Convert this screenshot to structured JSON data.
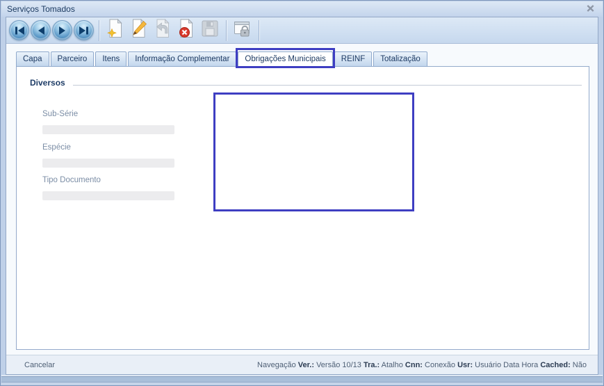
{
  "window": {
    "title": "Serviços Tomados"
  },
  "toolbar": {
    "buttons": [
      {
        "name": "first-record",
        "icon": "nav-first-icon",
        "enabled": true
      },
      {
        "name": "prior-record",
        "icon": "nav-prior-icon",
        "enabled": true
      },
      {
        "name": "next-record",
        "icon": "nav-next-icon",
        "enabled": true
      },
      {
        "name": "last-record",
        "icon": "nav-last-icon",
        "enabled": true
      },
      {
        "name": "new-record",
        "icon": "document-new-icon",
        "enabled": true
      },
      {
        "name": "edit-record",
        "icon": "document-edit-icon",
        "enabled": true
      },
      {
        "name": "undo-record",
        "icon": "document-undo-icon",
        "enabled": false
      },
      {
        "name": "delete-record",
        "icon": "document-delete-icon",
        "enabled": true
      },
      {
        "name": "save-record",
        "icon": "save-disk-icon",
        "enabled": false
      },
      {
        "name": "security",
        "icon": "window-lock-icon",
        "enabled": true
      }
    ]
  },
  "tabs": {
    "items": [
      {
        "label": "Capa",
        "active": false
      },
      {
        "label": "Parceiro",
        "active": false
      },
      {
        "label": "Itens",
        "active": false
      },
      {
        "label": "Informação Complementar",
        "active": false
      },
      {
        "label": "Obrigações Municipais",
        "active": true
      },
      {
        "label": "REINF",
        "active": false
      },
      {
        "label": "Totalização",
        "active": false
      }
    ]
  },
  "form": {
    "group_title": "Diversos",
    "fields": [
      {
        "label": "Sub-Série",
        "value": ""
      },
      {
        "label": "Espécie",
        "value": ""
      },
      {
        "label": "Tipo Documento",
        "value": ""
      }
    ]
  },
  "status_bar": {
    "left": "Cancelar",
    "right": [
      {
        "text": "Navegação ",
        "bold": false
      },
      {
        "text": "Ver.:",
        "bold": true
      },
      {
        "text": " Versão 10/13 ",
        "bold": false
      },
      {
        "text": "Tra.:",
        "bold": true
      },
      {
        "text": " Atalho ",
        "bold": false
      },
      {
        "text": "Cnn:",
        "bold": true
      },
      {
        "text": " Conexão ",
        "bold": false
      },
      {
        "text": "Usr:",
        "bold": true
      },
      {
        "text": " Usuário Data Hora ",
        "bold": false
      },
      {
        "text": "Cached:",
        "bold": true
      },
      {
        "text": " Não",
        "bold": false
      }
    ]
  },
  "colors": {
    "annotation_border": "#3e3ec2",
    "titlebar_text": "#1c3b61",
    "accent_blue": "#2f6ca0",
    "field_bar": "#ececee",
    "status_bg": "#e9eff7"
  }
}
